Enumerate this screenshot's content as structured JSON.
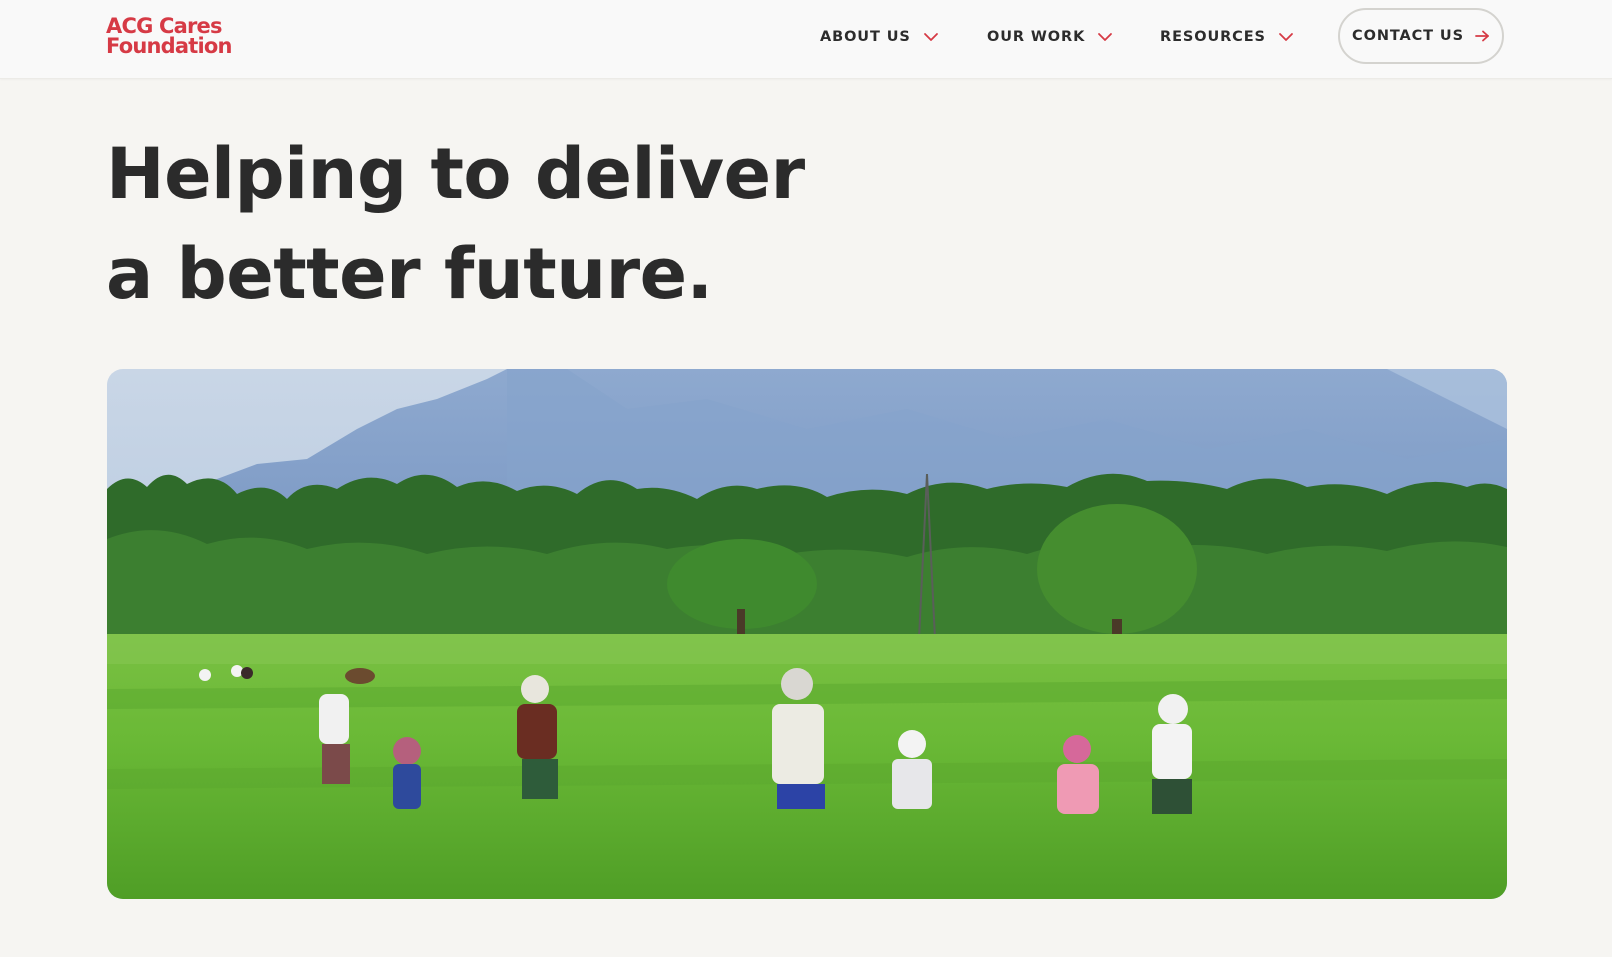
{
  "logo": {
    "line1": "ACG Cares",
    "line2": "Foundation"
  },
  "nav": {
    "items": [
      {
        "label": "ABOUT US"
      },
      {
        "label": "OUR WORK"
      },
      {
        "label": "RESOURCES"
      }
    ],
    "contact_label": "CONTACT US"
  },
  "hero": {
    "title": "Helping to deliver a better future."
  },
  "colors": {
    "brand": "#d63a45",
    "text": "#2b2b2b",
    "background": "#f6f5f2"
  },
  "icons": {
    "dropdown": "chevron-down-icon",
    "contact": "arrow-right-icon"
  }
}
